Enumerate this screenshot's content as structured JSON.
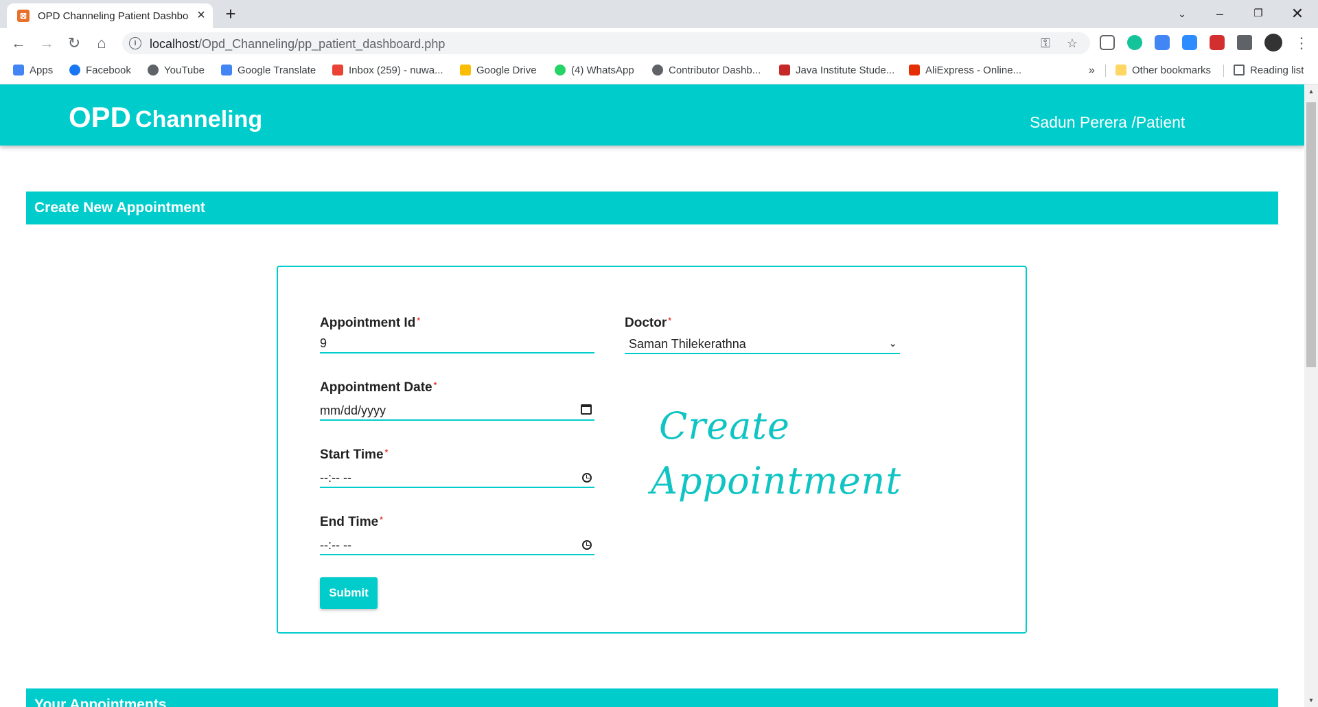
{
  "browser": {
    "tab_title": "OPD Channeling Patient Dashboard",
    "url_host": "localhost",
    "url_path": "/Opd_Channeling/pp_patient_dashboard.php",
    "bookmarks": [
      {
        "label": "Apps",
        "icon": "apps-grid-icon",
        "color": "#4285f4"
      },
      {
        "label": "Facebook",
        "icon": "facebook-icon",
        "color": "#1877f2"
      },
      {
        "label": "YouTube",
        "icon": "globe-icon",
        "color": "#5f6368"
      },
      {
        "label": "Google Translate",
        "icon": "translate-icon",
        "color": "#4285f4"
      },
      {
        "label": "Inbox (259) - nuwa...",
        "icon": "gmail-icon",
        "color": "#ea4335"
      },
      {
        "label": "Google Drive",
        "icon": "drive-icon",
        "color": "#fbbc04"
      },
      {
        "label": "(4) WhatsApp",
        "icon": "whatsapp-icon",
        "color": "#25d366"
      },
      {
        "label": "Contributor Dashb...",
        "icon": "globe-icon",
        "color": "#5f6368"
      },
      {
        "label": "Java Institute Stude...",
        "icon": "java-icon",
        "color": "#c62828"
      },
      {
        "label": "AliExpress - Online...",
        "icon": "aliexpress-icon",
        "color": "#e62e04"
      }
    ],
    "more_bookmarks": "»",
    "other_bookmarks": "Other bookmarks",
    "reading_list": "Reading list"
  },
  "app": {
    "brand_opd": "OPD",
    "brand_channeling": "Channeling",
    "user": "Sadun Perera /Patient",
    "accent": "#00cccc"
  },
  "create_section": {
    "title": "Create New Appointment"
  },
  "form": {
    "appointment_id_label": "Appointment Id",
    "appointment_id_value": "9",
    "doctor_label": "Doctor",
    "doctor_value": "Saman Thilekerathna",
    "date_label": "Appointment Date",
    "date_value": "mm/dd/yyyy",
    "start_time_label": "Start Time",
    "start_time_value": "--:-- --",
    "end_time_label": "End Time",
    "end_time_value": "--:-- --",
    "required_mark": "*",
    "submit_label": "Submit",
    "script_line1": "Create",
    "script_line2": "Appointment"
  },
  "appointments_section": {
    "title": "Your Appointments"
  }
}
